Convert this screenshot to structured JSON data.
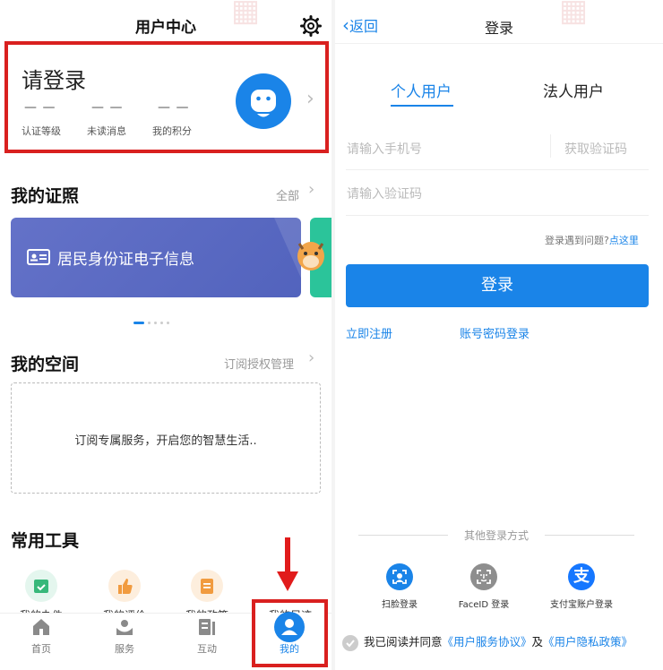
{
  "left": {
    "title": "用户中心",
    "profile": {
      "prompt": "请登录",
      "stats": [
        {
          "value": "— —",
          "label": "认证等级"
        },
        {
          "value": "— —",
          "label": "未读消息"
        },
        {
          "value": "— —",
          "label": "我的积分"
        }
      ]
    },
    "licenses": {
      "title": "我的证照",
      "more": "全部",
      "card_text": "居民身份证电子信息"
    },
    "space": {
      "title": "我的空间",
      "more": "订阅授权管理",
      "empty_text": "订阅专属服务，开启您的智慧生活.."
    },
    "tools": {
      "title": "常用工具",
      "items": [
        {
          "label": "我的办件",
          "color": "#e4f6ee",
          "accent": "#37b87a"
        },
        {
          "label": "我的评价",
          "color": "#fdeedd",
          "accent": "#f19b3f"
        },
        {
          "label": "我的政策",
          "color": "#fdeedd",
          "accent": "#f19b3f"
        },
        {
          "label": "我的足迹",
          "color": "#e5efff",
          "accent": "#1a84e8"
        }
      ]
    },
    "tabbar": [
      {
        "label": "首页"
      },
      {
        "label": "服务"
      },
      {
        "label": "互动"
      },
      {
        "label": "我的"
      }
    ]
  },
  "right": {
    "back": "返回",
    "title": "登录",
    "tabs": [
      "个人用户",
      "法人用户"
    ],
    "phone_placeholder": "请输入手机号",
    "get_code": "获取验证码",
    "code_placeholder": "请输入验证码",
    "help_prefix": "登录遇到问题?",
    "help_link": "点这里",
    "login_button": "登录",
    "register": "立即注册",
    "password_login": "账号密码登录",
    "other_title": "其他登录方式",
    "other_methods": [
      {
        "label": "扫脸登录",
        "icon": "face-scan-icon"
      },
      {
        "label": "FaceID 登录",
        "icon": "faceid-icon"
      },
      {
        "label": "支付宝账户登录",
        "icon": "alipay-icon"
      }
    ],
    "agreement": {
      "prefix": "我已阅读并同意",
      "service": "《用户服务协议》",
      "and": "及",
      "privacy": "《用户隐私政策》"
    }
  },
  "colors": {
    "accent": "#1a84e8",
    "highlight": "#d9201f"
  }
}
